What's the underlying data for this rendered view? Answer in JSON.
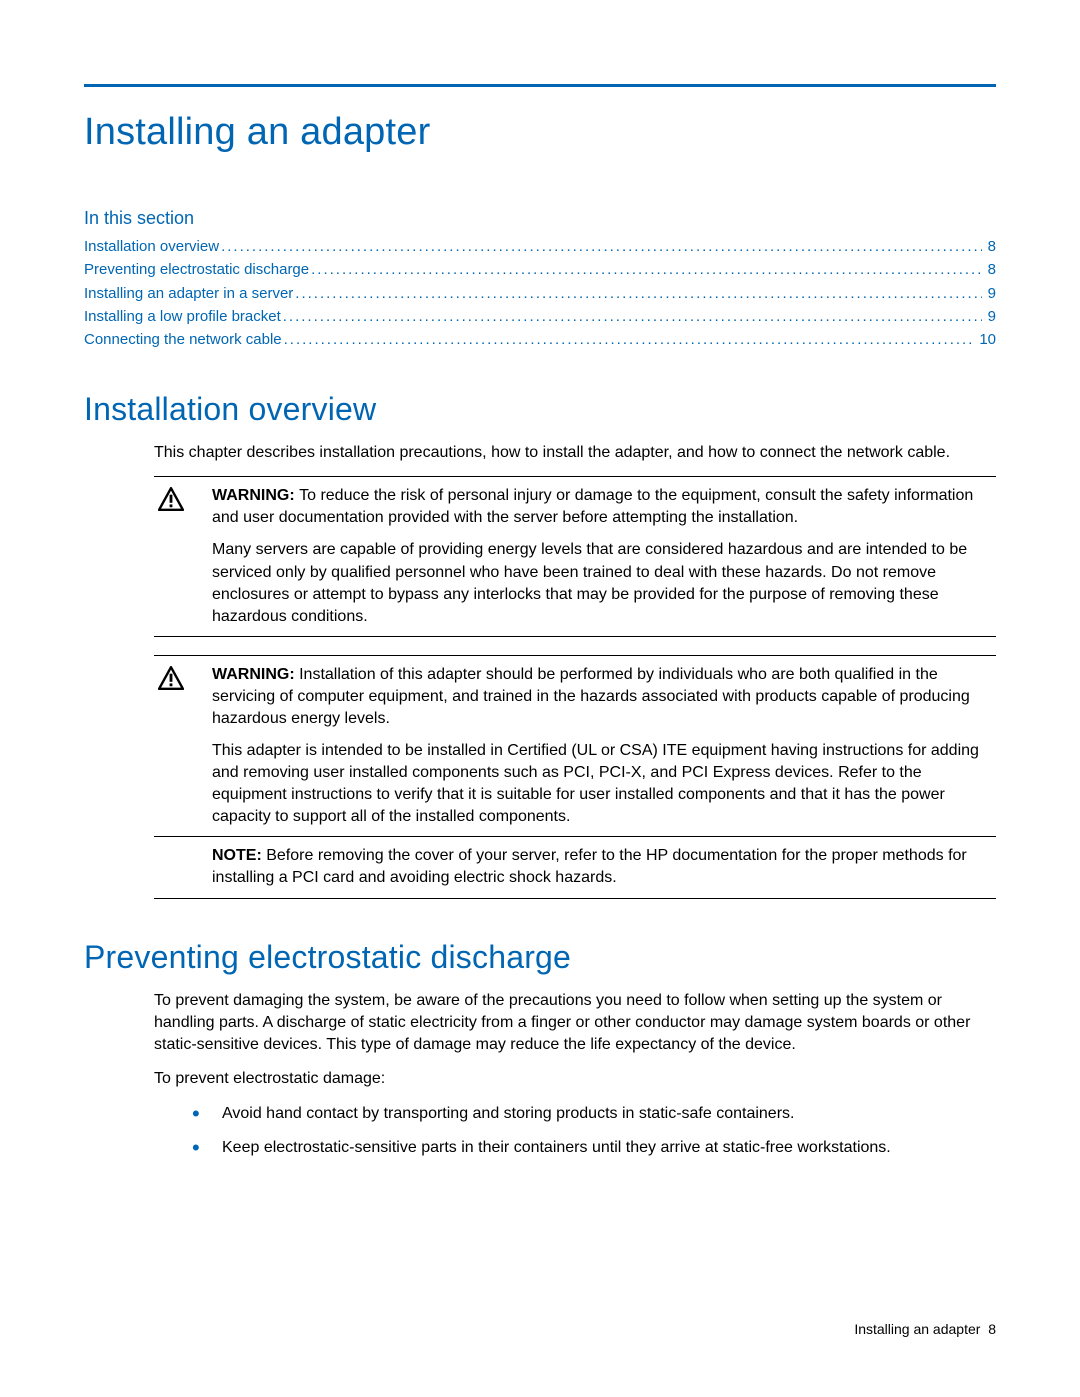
{
  "page_title": "Installing an adapter",
  "in_this_section_label": "In this section",
  "toc": [
    {
      "label": "Installation overview",
      "page": "8"
    },
    {
      "label": "Preventing electrostatic discharge",
      "page": "8"
    },
    {
      "label": "Installing an adapter in a server",
      "page": "9"
    },
    {
      "label": "Installing a low profile bracket",
      "page": "9"
    },
    {
      "label": "Connecting the network cable",
      "page": "10"
    }
  ],
  "section1": {
    "heading": "Installation overview",
    "intro": "This chapter describes installation precautions, how to install the adapter, and how to connect the network cable.",
    "warning1": {
      "label": "WARNING:",
      "text1": "To reduce the risk of personal injury or damage to the equipment, consult the safety information and user documentation provided with the server before attempting the installation.",
      "text2": "Many servers are capable of providing energy levels that are considered hazardous and are intended to be serviced only by qualified personnel who have been trained to deal with these hazards. Do not remove enclosures or attempt to bypass any interlocks that may be provided for the purpose of removing these hazardous conditions."
    },
    "warning2": {
      "label": "WARNING:",
      "text1": "Installation of this adapter should be performed by individuals who are both qualified in the servicing of computer equipment, and trained in the hazards associated with products capable of producing hazardous energy levels.",
      "text2": "This adapter is intended to be installed in Certified (UL or CSA) ITE equipment having instructions for adding and removing user installed components such as PCI, PCI-X, and PCI Express devices. Refer to the equipment instructions to verify that it is suitable for user installed components and that it has the power capacity to support all of the installed components."
    },
    "note": {
      "label": "NOTE:",
      "text": "Before removing the cover of your server, refer to the HP documentation for the proper methods for installing a PCI card and avoiding electric shock hazards."
    }
  },
  "section2": {
    "heading": "Preventing electrostatic discharge",
    "p1": "To prevent damaging the system, be aware of the precautions you need to follow when setting up the system or handling parts. A discharge of static electricity from a finger or other conductor may damage system boards or other static-sensitive devices. This type of damage may reduce the life expectancy of the device.",
    "p2": "To prevent electrostatic damage:",
    "bullets": [
      "Avoid hand contact by transporting and storing products in static-safe containers.",
      "Keep electrostatic-sensitive parts in their containers until they arrive at static-free workstations."
    ]
  },
  "footer": {
    "text": "Installing an adapter",
    "page": "8"
  }
}
